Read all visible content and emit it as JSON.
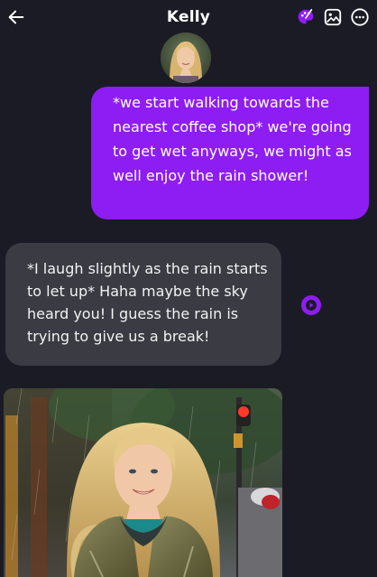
{
  "header": {
    "title": "Kelly",
    "back_icon": "arrow-left-icon",
    "actions": [
      "palette-icon",
      "image-icon",
      "more-icon"
    ],
    "accent": "#8e1df3"
  },
  "messages": [
    {
      "role": "user",
      "text": "*we start walking towards the nearest coffee shop* we're going to get wet anyways, we might as well enjoy the rain shower!"
    },
    {
      "role": "assistant",
      "text": "*I laugh slightly as the rain starts to let up* Haha maybe the sky heard you! I guess the rain is trying to give us a break!"
    }
  ],
  "colors": {
    "background": "#1b1b25",
    "user_bubble": "#8e1df3",
    "assistant_bubble": "#3b3b44"
  }
}
